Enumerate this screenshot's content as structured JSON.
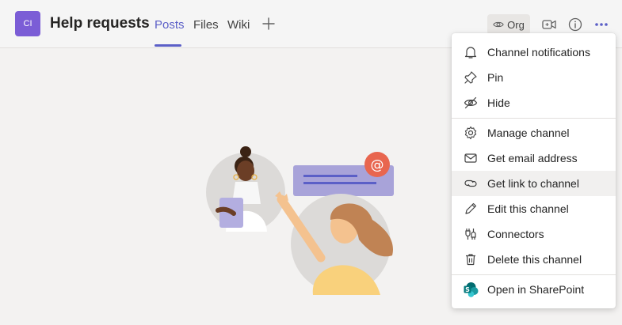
{
  "header": {
    "team_avatar": "CI",
    "title": "Help requests",
    "tabs": [
      {
        "label": "Posts",
        "active": true
      },
      {
        "label": "Files",
        "active": false
      },
      {
        "label": "Wiki",
        "active": false
      }
    ],
    "add_tab_icon": "plus-icon",
    "org_label": "Org",
    "org_icon": "eye-icon",
    "meet_icon": "video-camera-icon",
    "info_icon": "info-icon",
    "more_icon": "more-options-icon"
  },
  "menu": {
    "items": [
      {
        "label": "Channel notifications",
        "icon": "bell-icon"
      },
      {
        "label": "Pin",
        "icon": "pin-icon"
      },
      {
        "label": "Hide",
        "icon": "eye-off-icon"
      },
      {
        "label": "Manage channel",
        "icon": "gear-icon"
      },
      {
        "label": "Get email address",
        "icon": "mail-icon"
      },
      {
        "label": "Get link to channel",
        "icon": "link-icon",
        "hovered": true
      },
      {
        "label": "Edit this channel",
        "icon": "pencil-icon"
      },
      {
        "label": "Connectors",
        "icon": "plug-icon"
      },
      {
        "label": "Delete this channel",
        "icon": "trash-icon"
      },
      {
        "label": "Open in SharePoint",
        "icon": "sharepoint-icon"
      }
    ]
  },
  "colors": {
    "accent": "#5b5fc7",
    "team_avatar_bg": "#7b5dd6",
    "background": "#f3f2f1",
    "sharepoint": "#038387"
  }
}
